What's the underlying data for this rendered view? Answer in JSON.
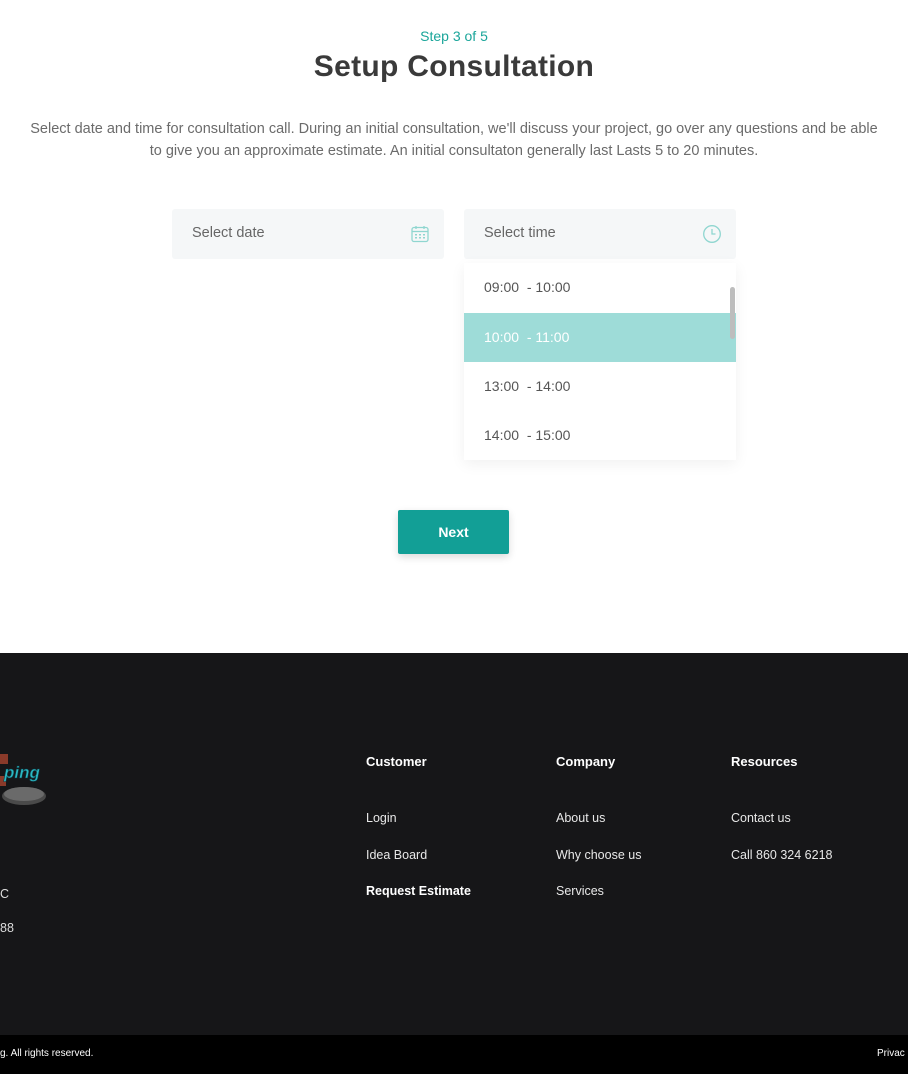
{
  "header": {
    "step": "Step 3 of 5",
    "title": "Setup Consultation",
    "description": "Select date and time for consultation call. During an initial consultation, we'll discuss your project, go over any questions and be able to give you an approximate estimate. An initial consultaton generally last Lasts 5 to 20 minutes."
  },
  "form": {
    "date_placeholder": "Select date",
    "time_placeholder": "Select time",
    "time_options": [
      {
        "label": "09:00  - 10:00",
        "selected": false
      },
      {
        "label": "10:00  - 11:00",
        "selected": true
      },
      {
        "label": "13:00  - 14:00",
        "selected": false
      },
      {
        "label": "14:00  - 15:00",
        "selected": false
      }
    ],
    "next_label": "Next"
  },
  "footer": {
    "logo_text": "ping",
    "partial_line1": "C",
    "partial_line2": "88",
    "columns": [
      {
        "title": "Customer",
        "links": [
          "Login",
          "Idea Board",
          "Request Estimate"
        ]
      },
      {
        "title": "Company",
        "links": [
          "About us",
          "Why choose us",
          "Services"
        ]
      },
      {
        "title": "Resources",
        "links": [
          "Contact us",
          "Call 860 324 6218"
        ]
      }
    ],
    "copyright": "g. All rights reserved.",
    "privacy": "Privac"
  },
  "colors": {
    "accent": "#129f96",
    "selected_option": "#9edcd8",
    "footer_bg": "#161618"
  },
  "icons": [
    "calendar-icon",
    "clock-icon"
  ]
}
